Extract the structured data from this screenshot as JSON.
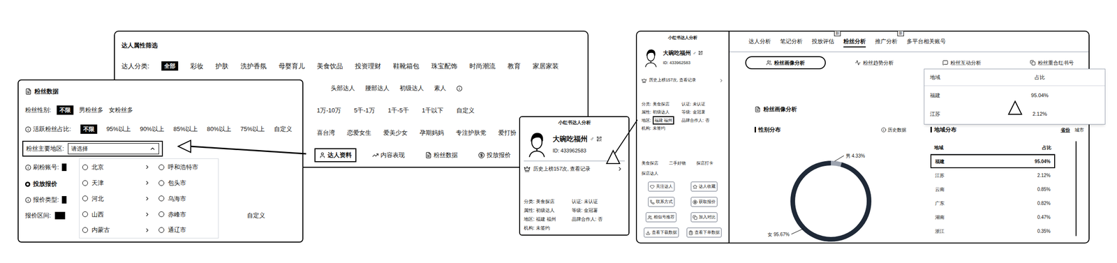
{
  "filter_panel": {
    "title": "达人属性筛选",
    "category_label": "达人分类:",
    "categories": [
      {
        "label": "全部",
        "selected": true
      },
      {
        "label": "彩妆",
        "selected": false
      },
      {
        "label": "护肤",
        "selected": false
      },
      {
        "label": "洗护香氛",
        "selected": false
      },
      {
        "label": "母婴育儿",
        "selected": false
      },
      {
        "label": "美食饮品",
        "selected": false
      },
      {
        "label": "投资理财",
        "selected": false
      },
      {
        "label": "鞋靴箱包",
        "selected": false
      },
      {
        "label": "珠宝配饰",
        "selected": false
      },
      {
        "label": "时尚潮流",
        "selected": false
      },
      {
        "label": "教育",
        "selected": false
      },
      {
        "label": "家居家装",
        "selected": false
      }
    ],
    "levels": [
      "头部达人",
      "腰部达人",
      "初级达人",
      "素人"
    ],
    "fan_counts": [
      "1万-10万",
      "5千-1万",
      "1千-5千",
      "1千以下",
      "自定义"
    ],
    "fan_tags": [
      "喜台湾",
      "恋爱女生",
      "爱美少女",
      "孕期妈妈",
      "专注护肤党",
      "爱打扮"
    ],
    "tabs": [
      {
        "label": "达人资料",
        "selected": true
      },
      {
        "label": "内容表现",
        "selected": false
      },
      {
        "label": "粉丝数据",
        "selected": false
      },
      {
        "label": "投放报价",
        "selected": false
      }
    ]
  },
  "fans_panel": {
    "title": "粉丝数据",
    "gender": {
      "label": "粉丝性别:",
      "options": [
        {
          "label": "不限",
          "selected": true
        },
        {
          "label": "男粉丝多",
          "selected": false
        },
        {
          "label": "女粉丝多",
          "selected": false
        }
      ]
    },
    "active_ratio": {
      "label": "活跃粉丝占比:",
      "options": [
        {
          "label": "不限",
          "selected": true
        },
        {
          "label": "95%以上",
          "selected": false
        },
        {
          "label": "90%以上",
          "selected": false
        },
        {
          "label": "85%以上",
          "selected": false
        },
        {
          "label": "80%以上",
          "selected": false
        },
        {
          "label": "75%以上",
          "selected": false
        },
        {
          "label": "自定义",
          "selected": false
        }
      ]
    },
    "region": {
      "label": "粉丝主要地区:",
      "placeholder": "请选择",
      "expanded": true
    },
    "region_menu": {
      "provinces": [
        {
          "label": "北京",
          "selected": false
        },
        {
          "label": "天津",
          "selected": false
        },
        {
          "label": "河北",
          "selected": false
        },
        {
          "label": "山西",
          "selected": false
        },
        {
          "label": "内蒙古",
          "selected": false
        }
      ],
      "cities": [
        {
          "label": "呼和浩特市",
          "selected": false
        },
        {
          "label": "包头市",
          "selected": false
        },
        {
          "label": "乌海市",
          "selected": false
        },
        {
          "label": "赤峰市",
          "selected": false
        },
        {
          "label": "通辽市",
          "selected": false
        }
      ]
    },
    "brush_label": "刷粉账号:",
    "quote_section": "投放报价",
    "quote_type_label": "报价类型:",
    "quote_range_label": "报价区间:",
    "quote_range_custom": "自定义"
  },
  "profile_card": {
    "title": "小红书达人分析",
    "name": "大碗吃福州",
    "gender": "♂",
    "id": "ID: 433962583",
    "history": "历史上榜157次, 查看记录",
    "info": [
      {
        "label": "分类:",
        "value": "美食探店",
        "highlighted": false
      },
      {
        "label": "认证:",
        "value": "未认证",
        "highlighted": false
      },
      {
        "label": "属性:",
        "value": "初级达人",
        "highlighted": false
      },
      {
        "label": "等级:",
        "value": "金冠薯",
        "highlighted": false
      },
      {
        "label": "地区:",
        "value": "福建 福州",
        "highlighted": false
      },
      {
        "label": "品牌合作人:",
        "value": "否",
        "highlighted": false
      },
      {
        "label": "机构:",
        "value": "未签约",
        "highlighted": false
      }
    ]
  },
  "analysis_panel": {
    "profile": {
      "title": "小红书达人分析",
      "name": "大碗吃福州",
      "gender": "♂",
      "id": "ID: 433962583",
      "history": "历史上榜157次, 查看记录",
      "info": [
        {
          "label": "分类:",
          "value": "美食探店",
          "highlighted": false
        },
        {
          "label": "认证:",
          "value": "未认证",
          "highlighted": false
        },
        {
          "label": "属性:",
          "value": "初级达人",
          "highlighted": false
        },
        {
          "label": "等级:",
          "value": "金冠薯",
          "highlighted": false
        },
        {
          "label": "地区:",
          "value": "福建 福州",
          "highlighted": true
        },
        {
          "label": "品牌合作人:",
          "value": "否",
          "highlighted": false
        },
        {
          "label": "机构:",
          "value": "未签约",
          "highlighted": false
        }
      ]
    },
    "tags": [
      "美食探店",
      "二手好物",
      "探店打卡",
      "探店达人"
    ],
    "actions": [
      "关注达人",
      "达人收藏",
      "联系方式",
      "获取报价",
      "相似号推荐",
      "加入对比",
      "查看下载数据",
      "查看下单数据"
    ],
    "tabs": [
      {
        "label": "达人分析",
        "selected": false
      },
      {
        "label": "笔记分析",
        "selected": false
      },
      {
        "label": "投放评估",
        "selected": false,
        "badge": "新"
      },
      {
        "label": "粉丝分析",
        "selected": true
      },
      {
        "label": "推广分析",
        "selected": false,
        "badge": "新"
      },
      {
        "label": "多平台相关账号",
        "selected": false
      }
    ],
    "sub_tabs": [
      {
        "label": "粉丝画像分析",
        "selected": true
      },
      {
        "label": "粉丝趋势分析",
        "selected": false
      },
      {
        "label": "粉丝互动分析",
        "selected": false
      },
      {
        "label": "粉丝重合红书号",
        "selected": false
      }
    ],
    "section_title": "粉丝画像分析",
    "gender_chart": {
      "title": "性别分布",
      "history": "历史数据",
      "labels": [
        "男 4.33%",
        "女 95.67%"
      ],
      "values": [
        4.33,
        95.67
      ]
    },
    "region_chart": {
      "title": "地域分布",
      "modes": [
        {
          "label": "省份",
          "selected": true
        },
        {
          "label": "城市",
          "selected": false
        }
      ],
      "columns": [
        "地域",
        "占比"
      ],
      "rows": [
        {
          "region": "福建",
          "share": "95.04%",
          "selected": true
        },
        {
          "region": "江苏",
          "share": "2.12%",
          "selected": false
        },
        {
          "region": "云南",
          "share": "0.85%",
          "selected": false
        },
        {
          "region": "广东",
          "share": "0.82%",
          "selected": false
        },
        {
          "region": "湖南",
          "share": "0.47%",
          "selected": false
        },
        {
          "region": "浙江",
          "share": "0.35%",
          "selected": false
        }
      ]
    }
  },
  "zoom_table": {
    "columns": [
      "地域",
      "占比"
    ],
    "rows": [
      {
        "region": "福建",
        "share": "95.04%"
      },
      {
        "region": "江苏",
        "share": "2.12%"
      }
    ]
  }
}
